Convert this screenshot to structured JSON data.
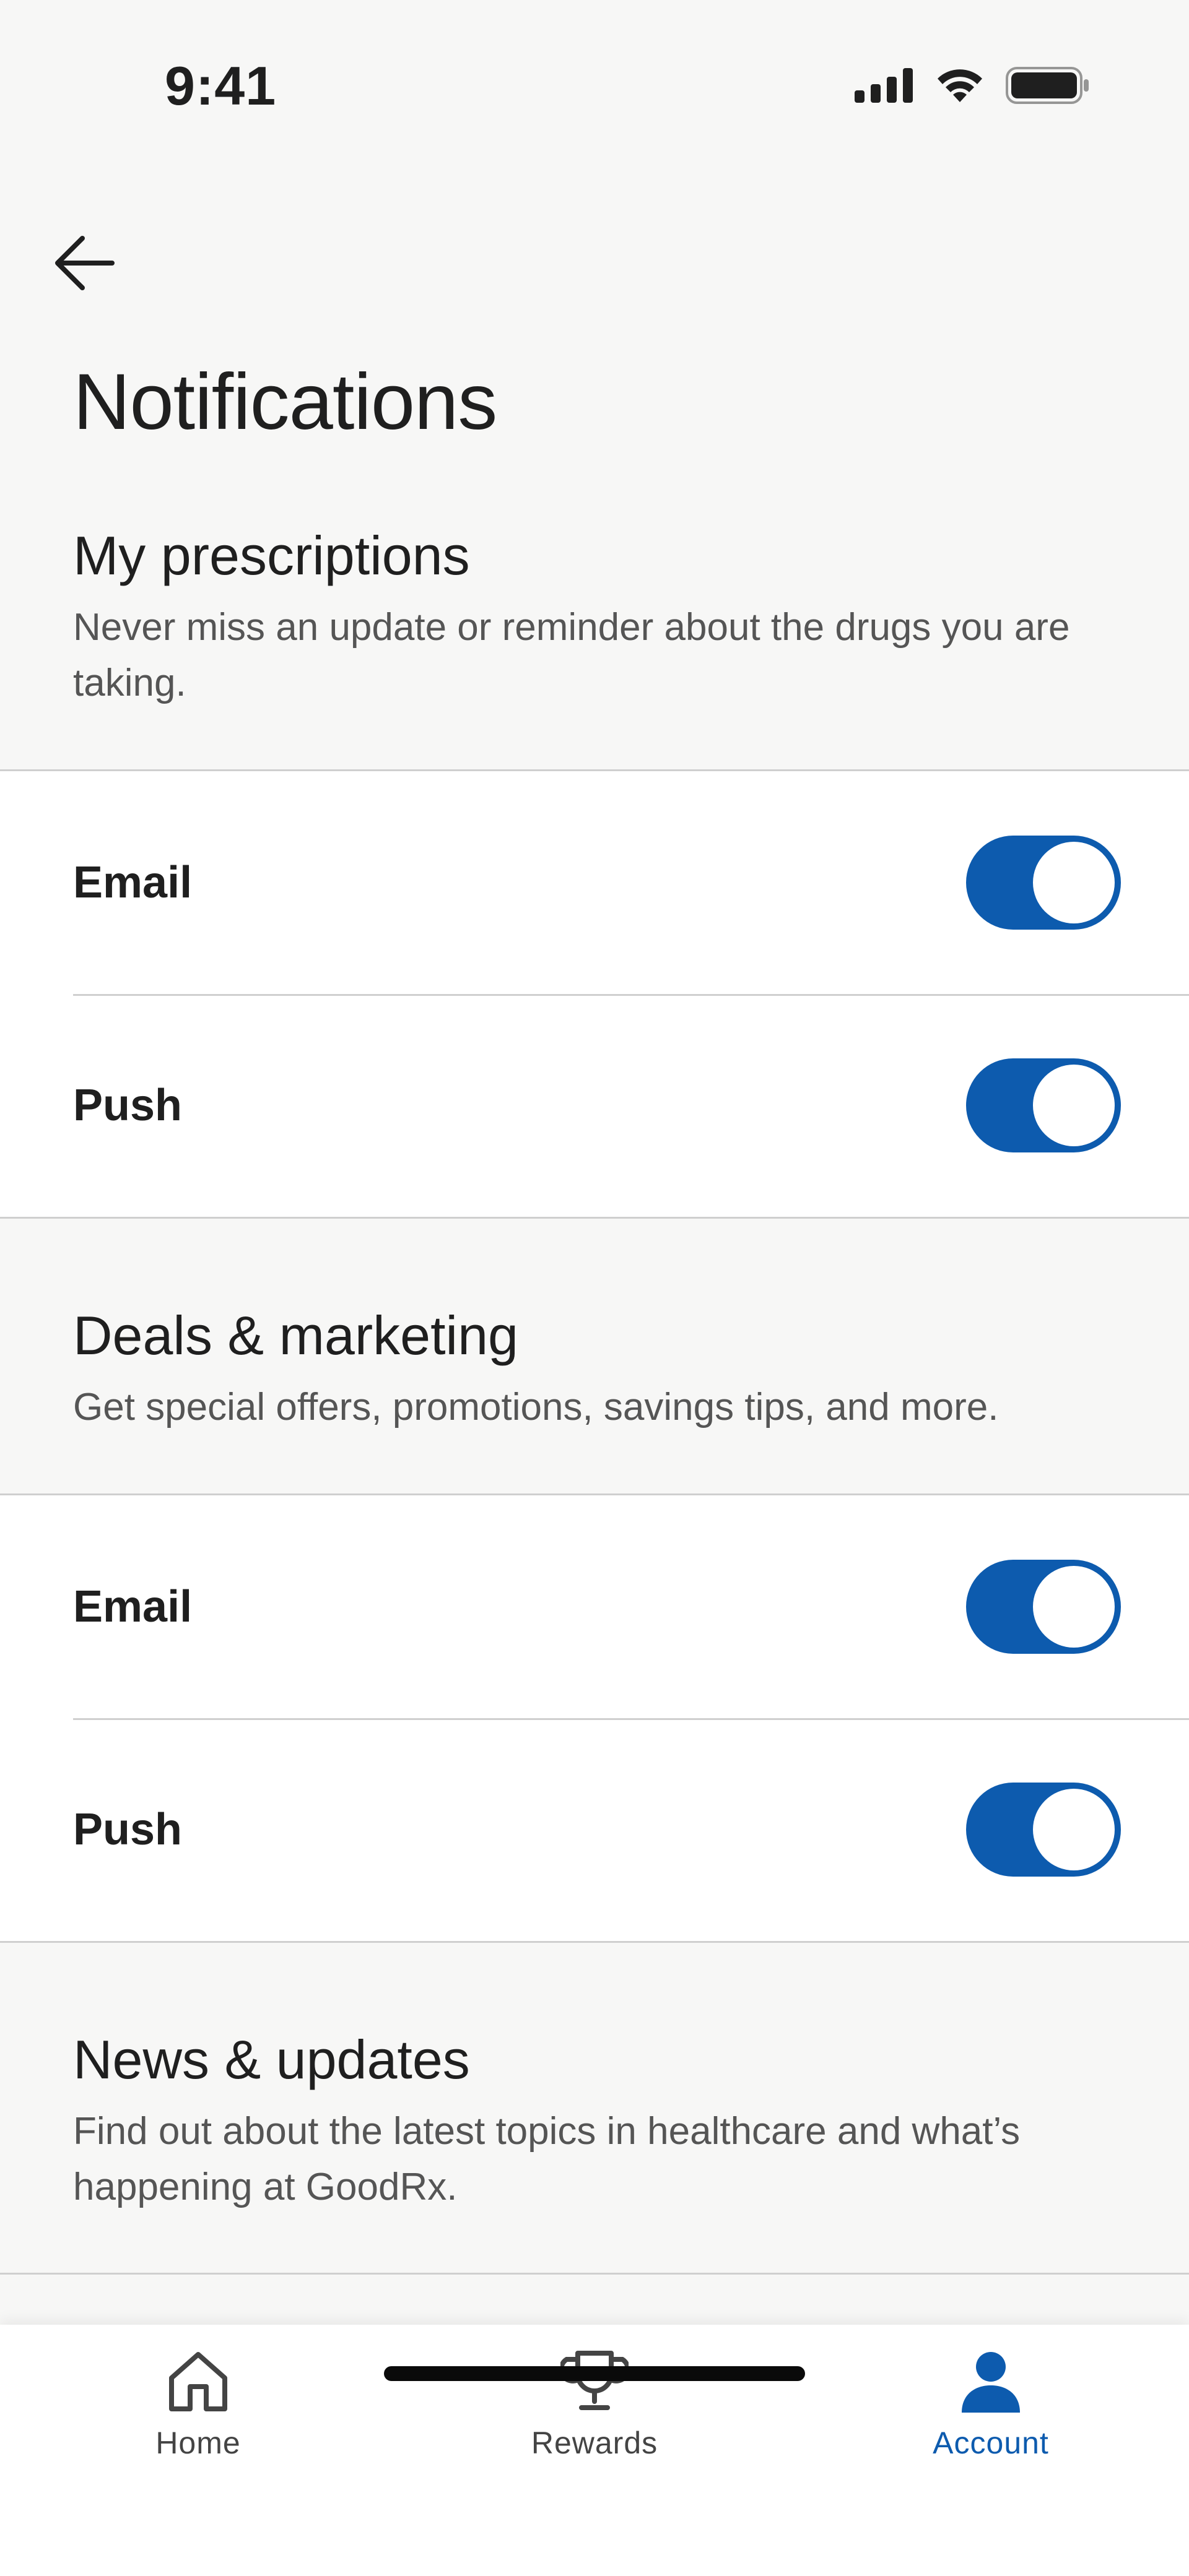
{
  "status_bar": {
    "time": "9:41",
    "icons": [
      "cellular-signal-icon",
      "wifi-icon",
      "battery-icon"
    ]
  },
  "header": {
    "title": "Notifications",
    "back_icon": "arrow-left-icon"
  },
  "sections": [
    {
      "title": "My prescriptions",
      "description": "Never miss an update or reminder about the drugs you are taking.",
      "rows": [
        {
          "label": "Email",
          "enabled": true
        },
        {
          "label": "Push",
          "enabled": true
        }
      ]
    },
    {
      "title": "Deals & marketing",
      "description": "Get special offers, promotions, savings tips, and more.",
      "rows": [
        {
          "label": "Email",
          "enabled": true
        },
        {
          "label": "Push",
          "enabled": true
        }
      ]
    },
    {
      "title": "News & updates",
      "description": "Find out about the latest topics in healthcare and what’s happening at GoodRx."
    }
  ],
  "tab_bar": {
    "tabs": [
      {
        "label": "Home",
        "icon": "home-icon",
        "active": false
      },
      {
        "label": "Rewards",
        "icon": "trophy-icon",
        "active": false
      },
      {
        "label": "Account",
        "icon": "person-icon",
        "active": true
      }
    ]
  },
  "colors": {
    "accent": "#0D5BAE",
    "background": "#F7F7F6",
    "card": "#FFFFFF",
    "divider": "#CFCFCF"
  }
}
